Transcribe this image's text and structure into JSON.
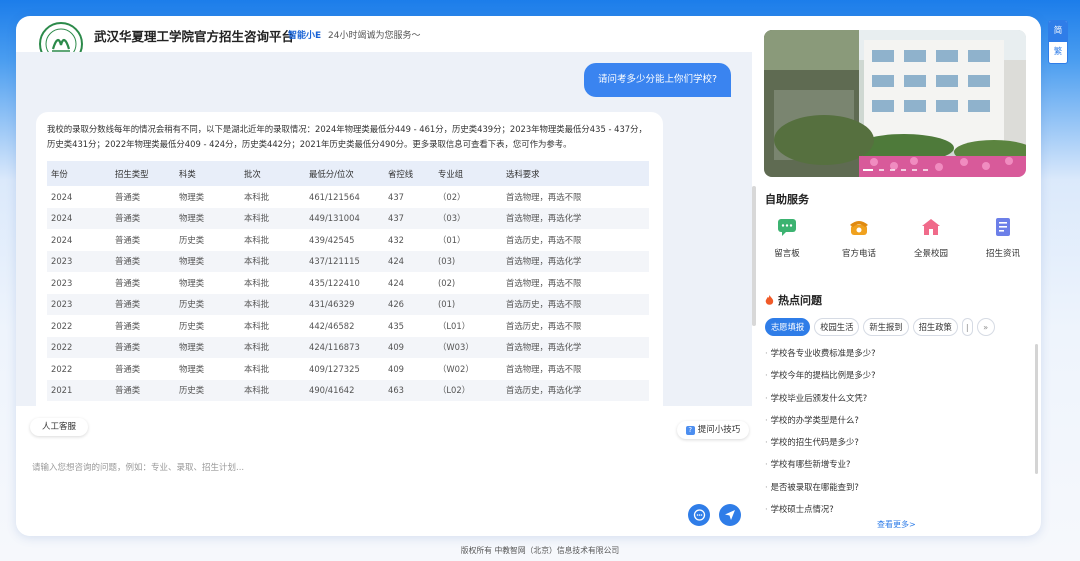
{
  "header": {
    "title": "武汉华夏理工学院官方招生咨询平台",
    "assistant_name": "智能小E",
    "assistant_tagline": "24小时竭诚为您服务～"
  },
  "chat": {
    "user_question": "请问考多少分能上你们学校?",
    "bot_answer": "我校的录取分数线每年的情况会稍有不同，以下是湖北近年的录取情况：2024年物理类最低分449 - 461分，历史类439分；2023年物理类最低分435 - 437分，历史类431分；2022年物理类最低分409 - 424分，历史类442分；2021年历史类最低分490分。更多录取信息可查看下表，您可作为参考。",
    "table": {
      "headers": [
        "年份",
        "招生类型",
        "科类",
        "批次",
        "最低分/位次",
        "省控线",
        "专业组",
        "选科要求"
      ],
      "rows": [
        [
          "2024",
          "普通类",
          "物理类",
          "本科批",
          "461/121564",
          "437",
          "（02）",
          "首选物理，再选不限"
        ],
        [
          "2024",
          "普通类",
          "物理类",
          "本科批",
          "449/131004",
          "437",
          "（03）",
          "首选物理，再选化学"
        ],
        [
          "2024",
          "普通类",
          "历史类",
          "本科批",
          "439/42545",
          "432",
          "（01）",
          "首选历史，再选不限"
        ],
        [
          "2023",
          "普通类",
          "物理类",
          "本科批",
          "437/121115",
          "424",
          "(03)",
          "首选物理，再选化学"
        ],
        [
          "2023",
          "普通类",
          "物理类",
          "本科批",
          "435/122410",
          "424",
          "(02)",
          "首选物理，再选不限"
        ],
        [
          "2023",
          "普通类",
          "历史类",
          "本科批",
          "431/46329",
          "426",
          "(01)",
          "首选历史，再选不限"
        ],
        [
          "2022",
          "普通类",
          "历史类",
          "本科批",
          "442/46582",
          "435",
          "（L01）",
          "首选历史，再选不限"
        ],
        [
          "2022",
          "普通类",
          "物理类",
          "本科批",
          "424/116873",
          "409",
          "（W03）",
          "首选物理，再选化学"
        ],
        [
          "2022",
          "普通类",
          "物理类",
          "本科批",
          "409/127325",
          "409",
          "（W02）",
          "首选物理，再选不限"
        ],
        [
          "2021",
          "普通类",
          "历史类",
          "本科批",
          "490/41642",
          "463",
          "（L02）",
          "首选历史，再选化学"
        ]
      ]
    },
    "human_service_label": "人工客服",
    "tips_label": "提问小技巧",
    "input_placeholder": "请输入您想咨询的问题，例如：专业、录取、招生计划..."
  },
  "right_panel": {
    "self_service_title": "自助服务",
    "services": [
      {
        "label": "留言板",
        "icon": "message-board-icon",
        "color": "#3cb371"
      },
      {
        "label": "官方电话",
        "icon": "phone-icon",
        "color": "#f0a11e"
      },
      {
        "label": "全景校园",
        "icon": "campus-icon",
        "color": "#f06a8a"
      },
      {
        "label": "招生资讯",
        "icon": "news-icon",
        "color": "#6c7fe8"
      }
    ],
    "hot_title": "热点问题",
    "tabs": [
      "志愿填报",
      "校园生活",
      "新生报到",
      "招生政策",
      "|"
    ],
    "more_tabs_label": "»",
    "questions": [
      "学校各专业收费标准是多少?",
      "学校今年的提档比例是多少?",
      "学校毕业后颁发什么文凭?",
      "学校的办学类型是什么?",
      "学校的招生代码是多少?",
      "学校有哪些新增专业?",
      "是否被录取在哪能查到?",
      "学校硕士点情况?"
    ],
    "see_more": "查看更多>"
  },
  "lang": {
    "simplified": "简",
    "traditional": "繁"
  },
  "footer": "版权所有  中教智网（北京）信息技术有限公司",
  "colors": {
    "accent": "#2f7de8",
    "user_bubble": "#3a84f0",
    "chat_bg": "#edf1f8",
    "logo_green": "#2c8a4a"
  }
}
